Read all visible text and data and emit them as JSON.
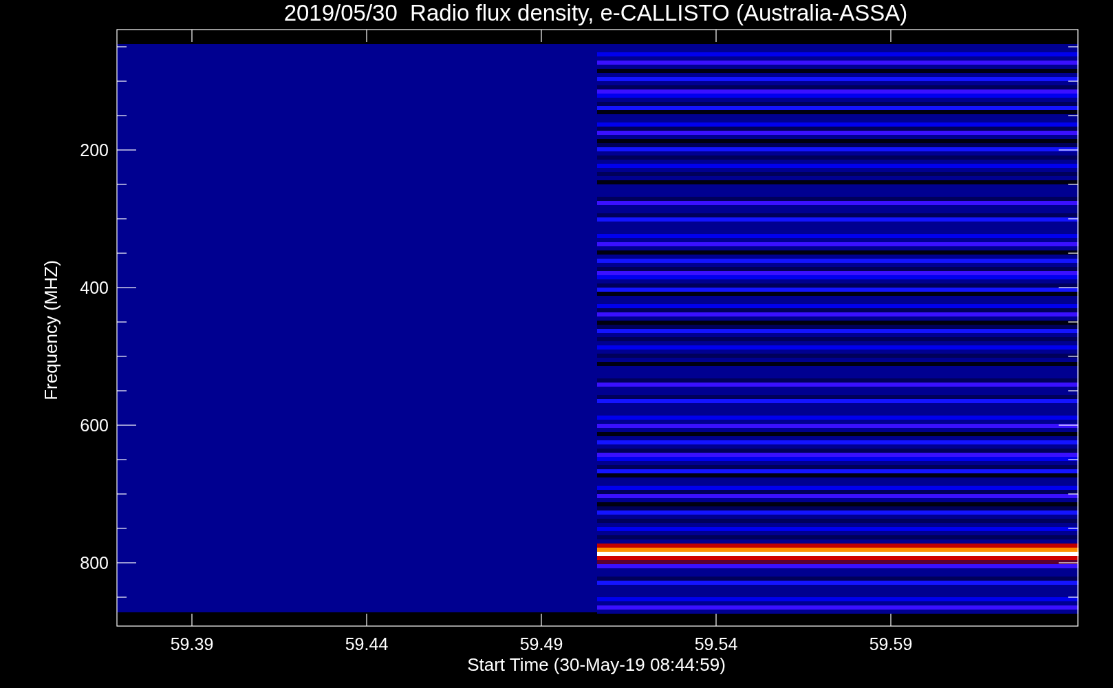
{
  "chart": {
    "title": "2019/05/30  Radio flux density, e-CALLISTO (Australia-ASSA)",
    "ylabel": "Frequency (MHZ)",
    "xlabel": "Start Time (30-May-19 08:44:59)",
    "yticks": [
      "200",
      "400",
      "600",
      "800"
    ],
    "xticks": [
      "59.39",
      "59.44",
      "59.49",
      "59.54",
      "59.59"
    ]
  }
}
